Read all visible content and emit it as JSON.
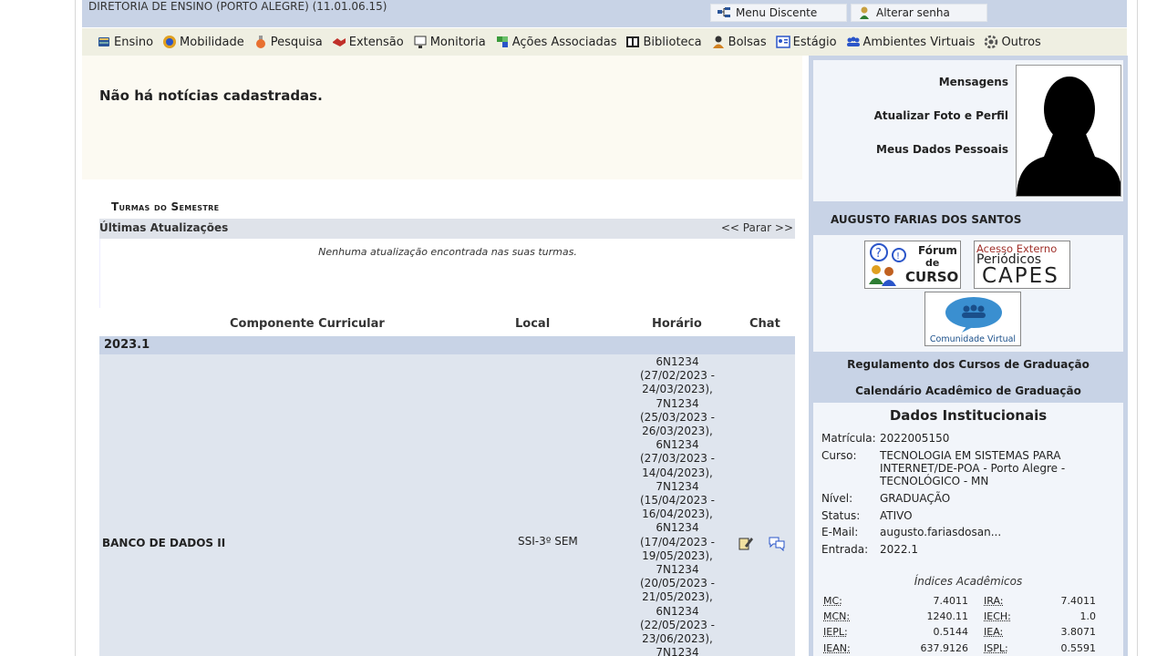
{
  "header": {
    "department": "DIRETORIA DE ENSINO (PORTO ALEGRE) (11.01.06.15)",
    "menu_discente": "Menu Discente",
    "alterar_senha": "Alterar senha"
  },
  "menu": [
    {
      "label": "Ensino",
      "icon": "book-icon"
    },
    {
      "label": "Mobilidade",
      "icon": "globe-icon"
    },
    {
      "label": "Pesquisa",
      "icon": "flask-icon"
    },
    {
      "label": "Extensão",
      "icon": "handshake-icon"
    },
    {
      "label": "Monitoria",
      "icon": "monitor-icon"
    },
    {
      "label": "Ações Associadas",
      "icon": "puzzle-icon"
    },
    {
      "label": "Biblioteca",
      "icon": "library-icon"
    },
    {
      "label": "Bolsas",
      "icon": "person-icon"
    },
    {
      "label": "Estágio",
      "icon": "id-card-icon"
    },
    {
      "label": "Ambientes Virtuais",
      "icon": "people-icon"
    },
    {
      "label": "Outros",
      "icon": "gear-icon"
    }
  ],
  "news": {
    "message": "Não há notícias cadastradas."
  },
  "turmas": {
    "title": "Turmas do Semestre",
    "updates_title": "Últimas Atualizações",
    "updates_nav": "<< Parar >>",
    "updates_message": "Nenhuma atualização encontrada nas suas turmas.",
    "columns": {
      "componente": "Componente Curricular",
      "local": "Local",
      "horario": "Horário",
      "chat": "Chat"
    },
    "semester": "2023.1",
    "rows": [
      {
        "name": "BANCO DE DADOS II",
        "local": "SSI-3º SEM",
        "schedule": "6N1234 (27/02/2023 - 24/03/2023), 7N1234 (25/03/2023 - 26/03/2023), 6N1234 (27/03/2023 - 14/04/2023), 7N1234 (15/04/2023 - 16/04/2023), 6N1234 (17/04/2023 - 19/05/2023), 7N1234 (20/05/2023 - 21/05/2023), 6N1234 (22/05/2023 - 23/06/2023), 7N1234"
      }
    ]
  },
  "profile": {
    "mensagens": "Mensagens",
    "atualizar_foto": "Atualizar Foto e Perfil",
    "meus_dados": "Meus Dados Pessoais",
    "name": "AUGUSTO FARIAS DOS SANTOS"
  },
  "badges": {
    "forum_line1": "Fórum",
    "forum_line2": "de",
    "forum_line3": "CURSO",
    "capes_line1": "Acesso Externo",
    "capes_line2": "Periódicos",
    "capes_line3": "CAPES",
    "comunidade": "Comunidade Virtual"
  },
  "links": {
    "regulamento": "Regulamento dos Cursos de Graduação",
    "calendario": "Calendário Acadêmico de Graduação"
  },
  "institutional": {
    "title": "Dados Institucionais",
    "matricula_label": "Matrícula:",
    "matricula": "2022005150",
    "curso_label": "Curso:",
    "curso": "TECNOLOGIA EM SISTEMAS PARA INTERNET/DE-POA - Porto Alegre - TECNOLÓGICO - MN",
    "nivel_label": "Nível:",
    "nivel": "GRADUAÇÃO",
    "status_label": "Status:",
    "status": "ATIVO",
    "email_label": "E-Mail:",
    "email": "augusto.fariasdosan...",
    "entrada_label": "Entrada:",
    "entrada": "2022.1",
    "indices_title": "Índices Acadêmicos",
    "indices": [
      {
        "k": "MC:",
        "v": "7.4011",
        "k2": "IRA:",
        "v2": "7.4011"
      },
      {
        "k": "MCN:",
        "v": "1240.11",
        "k2": "IECH:",
        "v2": "1.0"
      },
      {
        "k": "IEPL:",
        "v": "0.5144",
        "k2": "IEA:",
        "v2": "3.8071"
      },
      {
        "k": "IEAN:",
        "v": "637.9126",
        "k2": "ISPL:",
        "v2": "0.5591"
      }
    ]
  },
  "colors": {
    "header_blue": "#c8d3e6",
    "menu_bg": "#efefe2",
    "row_bg": "#dfe5ee"
  }
}
